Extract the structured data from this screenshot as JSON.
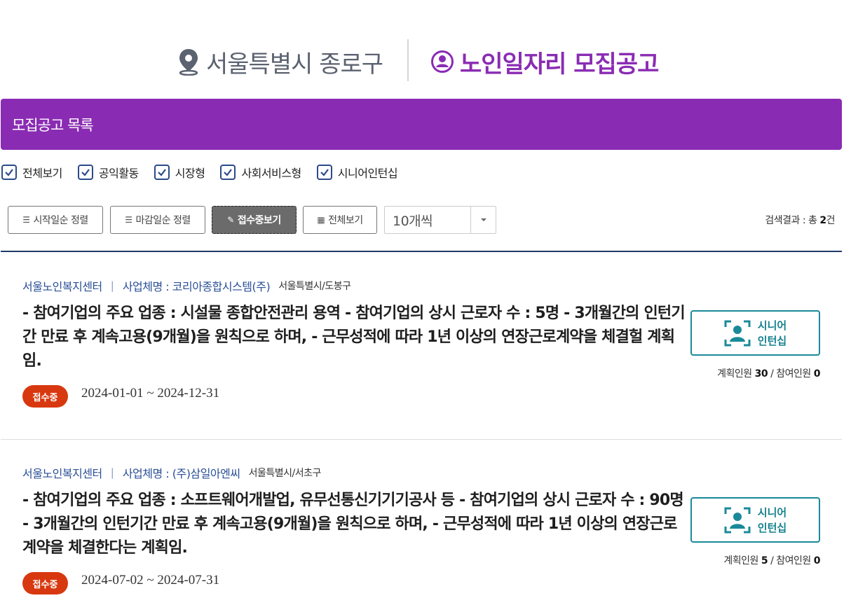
{
  "header": {
    "region": "서울특별시 종로구",
    "title": "노인일자리 모집공고"
  },
  "list_bar": {
    "title": "모집공고 목록"
  },
  "filters": [
    {
      "label": "전체보기",
      "checked": true
    },
    {
      "label": "공익활동",
      "checked": true
    },
    {
      "label": "시장형",
      "checked": true
    },
    {
      "label": "사회서비스형",
      "checked": true
    },
    {
      "label": "시니어인턴십",
      "checked": true
    }
  ],
  "toolbar": {
    "sort_start_label": "시작일순 정렬",
    "sort_end_label": "마감일순 정렬",
    "receiving_label": "접수중보기",
    "view_all_label": "전체보기",
    "page_size": "10개씩",
    "result_prefix": "검색결과 : 총 ",
    "result_count": "2",
    "result_suffix": "건"
  },
  "postings": [
    {
      "org": "서울노인복지센터",
      "separator": "|",
      "business": "사업체명 : 코리아종합시스템(주)",
      "location": "서울특별시/도봉구",
      "description": "- 참여기업의 주요 업종 : 시설물 종합안전관리 용역 - 참여기업의 상시 근로자 수 : 5명 - 3개월간의 인턴기간 만료 후 계속고용(9개월)을 원칙으로 하며, - 근무성적에 따라 1년 이상의 연장근로계약을 체결헐 계획임.",
      "status": "접수중",
      "period": "2024-01-01 ~ 2024-12-31",
      "type_line1": "시니어",
      "type_line2": "인턴십",
      "planned_label": "계획인원 ",
      "planned": "30",
      "count_sep": " / ",
      "joined_label": "참여인원 ",
      "joined": "0"
    },
    {
      "org": "서울노인복지센터",
      "separator": "|",
      "business": "사업체명 : (주)삼일아엔씨",
      "location": "서울특별시/서초구",
      "description": "- 참여기업의 주요 업종 : 소프트웨어개발업, 유무선통신기기기공사 등 - 참여기업의 상시 근로자 수 : 90명 - 3개월간의 인턴기간 만료 후 계속고용(9개월)을 원칙으로 하며, - 근무성적에 따라 1년 이상의 연장근로계약을 체결한다는 계획임.",
      "status": "접수중",
      "period": "2024-07-02 ~ 2024-07-31",
      "type_line1": "시니어",
      "type_line2": "인턴십",
      "planned_label": "계획인원 ",
      "planned": "5",
      "count_sep": " / ",
      "joined_label": "참여인원 ",
      "joined": "0"
    }
  ],
  "colors": {
    "accent_purple": "#8a2cb3",
    "navy": "#1f3a68",
    "status_red": "#d8380f",
    "teal": "#1a8a99"
  },
  "icons": [
    "location-pin-icon",
    "user-circle-icon",
    "checkbox-check-icon",
    "list-icon",
    "pencil-icon",
    "grid-icon",
    "chevron-down-icon",
    "senior-intern-icon"
  ]
}
